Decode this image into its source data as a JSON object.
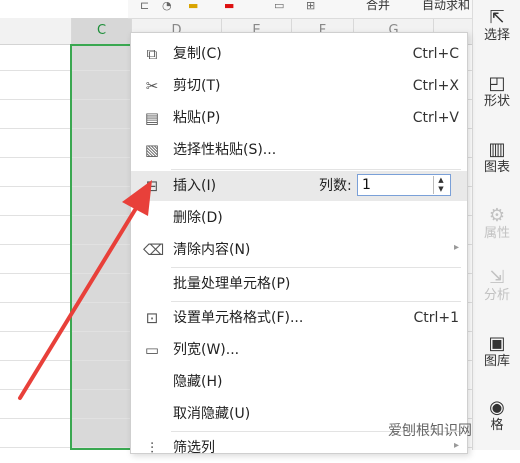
{
  "sheet": {
    "columns": [
      "C",
      "D",
      "E",
      "F",
      "G"
    ],
    "selected_column": "C",
    "accent_color": "#3aa851"
  },
  "toolbar_top": {
    "merge_label": "合并",
    "autosum_label": "自动求和"
  },
  "side_panel": {
    "items": [
      {
        "label": "选择",
        "icon": "cursor-icon",
        "enabled": true
      },
      {
        "label": "形状",
        "icon": "shape-icon",
        "enabled": true
      },
      {
        "label": "图表",
        "icon": "chart-icon",
        "enabled": true
      },
      {
        "label": "属性",
        "icon": "properties-icon",
        "enabled": false
      },
      {
        "label": "分析",
        "icon": "analysis-icon",
        "enabled": false
      },
      {
        "label": "图库",
        "icon": "gallery-icon",
        "enabled": true
      },
      {
        "label": "格",
        "icon": "style-icon",
        "enabled": true
      }
    ]
  },
  "context_menu": {
    "items": [
      {
        "label": "复制(C)",
        "shortcut": "Ctrl+C",
        "icon": "copy-icon"
      },
      {
        "label": "剪切(T)",
        "shortcut": "Ctrl+X",
        "icon": "cut-icon"
      },
      {
        "label": "粘贴(P)",
        "shortcut": "Ctrl+V",
        "icon": "paste-icon"
      },
      {
        "label": "选择性粘贴(S)...",
        "shortcut": "",
        "icon": "paste-special-icon"
      },
      {
        "label": "插入(I)",
        "shortcut": "",
        "icon": "insert-icon",
        "highlighted": true
      },
      {
        "label": "删除(D)",
        "shortcut": "",
        "icon": ""
      },
      {
        "label": "清除内容(N)",
        "shortcut": "",
        "icon": "eraser-icon",
        "submenu": true
      },
      {
        "label": "批量处理单元格(P)",
        "shortcut": "",
        "icon": ""
      },
      {
        "label": "设置单元格格式(F)...",
        "shortcut": "Ctrl+1",
        "icon": "format-cells-icon"
      },
      {
        "label": "列宽(W)...",
        "shortcut": "",
        "icon": "column-width-icon"
      },
      {
        "label": "隐藏(H)",
        "shortcut": "",
        "icon": ""
      },
      {
        "label": "取消隐藏(U)",
        "shortcut": "",
        "icon": ""
      },
      {
        "label": "筛选列",
        "shortcut": "",
        "icon": "filter-icon",
        "submenu": true
      }
    ],
    "insert_columns": {
      "label": "列数:",
      "value": "1"
    }
  },
  "watermark": "爱刨根知识网",
  "annotation_color": "#e8403a"
}
